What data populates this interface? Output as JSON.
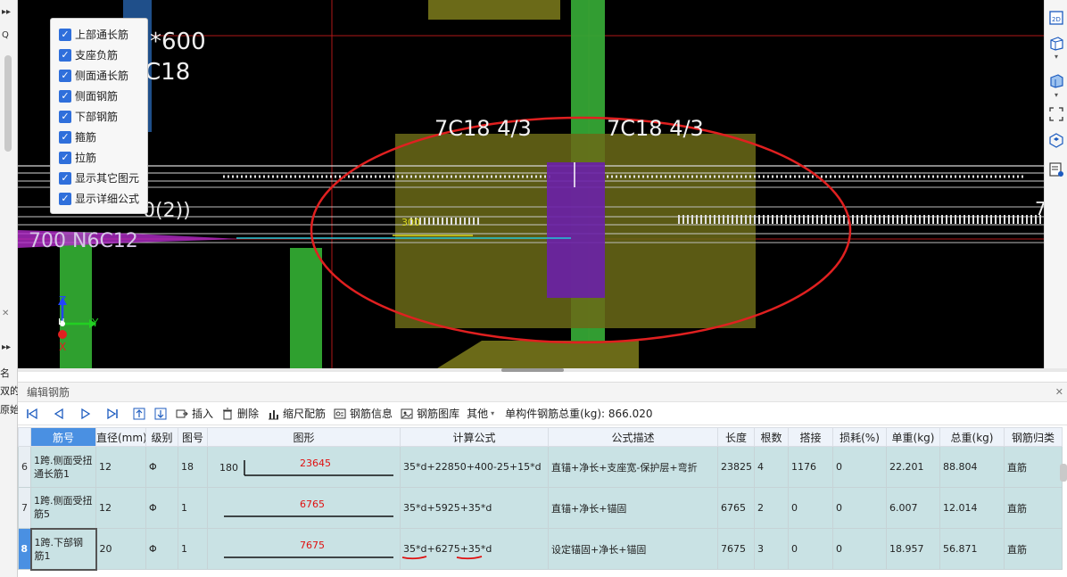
{
  "left_strip": {
    "glyphs": [
      "▸▸",
      "Q",
      "✕",
      "▸▸"
    ],
    "texts": [
      "名",
      "双的",
      "原始"
    ]
  },
  "viewport": {
    "labels": {
      "beam_size": "*600",
      "beam_bar": "C18",
      "top_bar_left": "7C18 4/3",
      "top_bar_right": "7C18 4/3",
      "stirrup_spec": "0(2))",
      "side_bar_spec": "700 N6C12",
      "small_label": "300",
      "edge_label": "7"
    },
    "axes": {
      "z": "Z",
      "y": "Y",
      "x": "X",
      "h": "H"
    },
    "colors": {
      "highlight_ellipse": "#e02020",
      "column_green": "#2fa02f",
      "purple_block": "#6a1fa8",
      "olive_block": "#6b6a18"
    }
  },
  "layer_panel": {
    "items": [
      {
        "label": "上部通长筋",
        "checked": true
      },
      {
        "label": "支座负筋",
        "checked": true
      },
      {
        "label": "侧面通长筋",
        "checked": true
      },
      {
        "label": "侧面钢筋",
        "checked": true
      },
      {
        "label": "下部钢筋",
        "checked": true
      },
      {
        "label": "箍筋",
        "checked": true
      },
      {
        "label": "拉筋",
        "checked": true
      },
      {
        "label": "显示其它图元",
        "checked": true
      },
      {
        "label": "显示详细公式",
        "checked": true
      }
    ]
  },
  "right_toolbar": {
    "icons": [
      "2d-view-icon",
      "3d-cube-icon",
      "chevron-down-icon",
      "3d-cube-blue-icon",
      "chevron-down-icon",
      "fullscreen-icon",
      "3d-view-icon",
      "properties-icon"
    ],
    "labels": {
      "two_d": "2D"
    }
  },
  "edit_panel": {
    "title": "编辑钢筋",
    "close_glyph": "✕",
    "toolbar": {
      "insert": "插入",
      "delete": "删除",
      "scale_rebar": "缩尺配筋",
      "rebar_info": "钢筋信息",
      "rebar_library": "钢筋图库",
      "other": "其他",
      "other_caret": "▾",
      "total_weight": "单构件钢筋总重(kg): 866.020"
    },
    "columns": [
      "筋号",
      "直径(mm)",
      "级别",
      "图号",
      "图形",
      "计算公式",
      "公式描述",
      "长度",
      "根数",
      "搭接",
      "损耗(%)",
      "单重(kg)",
      "总重(kg)",
      "钢筋归类"
    ],
    "rows": [
      {
        "num": "6",
        "name": "1跨.侧面受扭通长筋1",
        "diameter": "12",
        "grade": "Φ",
        "shape_no": "18",
        "shape_left": "180",
        "shape_len": "23645",
        "formula": "35*d+22850+400-25+15*d",
        "desc": "直锚+净长+支座宽-保护层+弯折",
        "length": "23825",
        "count": "4",
        "lap": "1176",
        "loss": "0",
        "unit_wt": "22.201",
        "total_wt": "88.804",
        "category": "直筋"
      },
      {
        "num": "7",
        "name": "1跨.侧面受扭筋5",
        "diameter": "12",
        "grade": "Φ",
        "shape_no": "1",
        "shape_left": "",
        "shape_len": "6765",
        "formula": "35*d+5925+35*d",
        "desc": "直锚+净长+锚固",
        "length": "6765",
        "count": "2",
        "lap": "0",
        "loss": "0",
        "unit_wt": "6.007",
        "total_wt": "12.014",
        "category": "直筋"
      },
      {
        "num": "8",
        "name": "1跨.下部钢筋1",
        "diameter": "20",
        "grade": "Φ",
        "shape_no": "1",
        "shape_left": "",
        "shape_len": "7675",
        "formula": "35*d+6275+35*d",
        "desc": "设定锚固+净长+锚固",
        "length": "7675",
        "count": "3",
        "lap": "0",
        "loss": "0",
        "unit_wt": "18.957",
        "total_wt": "56.871",
        "category": "直筋"
      }
    ]
  }
}
